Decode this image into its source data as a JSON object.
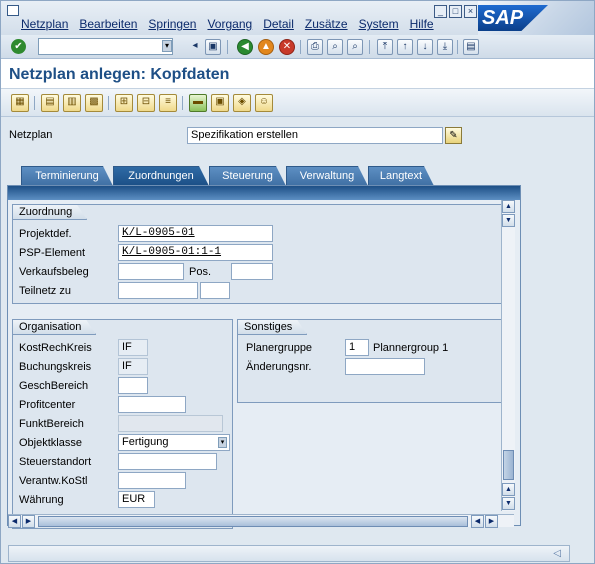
{
  "menubar": {
    "items": [
      "Netzplan",
      "Bearbeiten",
      "Springen",
      "Vorgang",
      "Detail",
      "Zusätze",
      "System",
      "Hilfe"
    ],
    "logo": "SAP"
  },
  "stdbar": {
    "command_value": ""
  },
  "title": "Netzplan anlegen: Kopfdaten",
  "header": {
    "netzplan_label": "Netzplan",
    "netzplan_value": "Spezifikation erstellen"
  },
  "tabs": [
    {
      "label": "Terminierung",
      "active": false
    },
    {
      "label": "Zuordnungen",
      "active": true
    },
    {
      "label": "Steuerung",
      "active": false
    },
    {
      "label": "Verwaltung",
      "active": false
    },
    {
      "label": "Langtext",
      "active": false
    }
  ],
  "zuordnung": {
    "title": "Zuordnung",
    "projektdef_label": "Projektdef.",
    "projektdef_value": "K/L-0905-01",
    "psp_label": "PSP-Element",
    "psp_value": "K/L-0905-01:1-1",
    "verkaufsbeleg_label": "Verkaufsbeleg",
    "verkaufsbeleg_value": "",
    "pos_label": "Pos.",
    "pos_value": "",
    "teilnetz_label": "Teilnetz zu",
    "teilnetz_value": "",
    "teilnetz_value2": ""
  },
  "organisation": {
    "title": "Organisation",
    "kostrechkreis_label": "KostRechKreis",
    "kostrechkreis_value": "IF",
    "buchungskreis_label": "Buchungskreis",
    "buchungskreis_value": "IF",
    "geschbereich_label": "GeschBereich",
    "geschbereich_value": "",
    "profitcenter_label": "Profitcenter",
    "profitcenter_value": "",
    "funktbereich_label": "FunktBereich",
    "funktbereich_value": "",
    "objektklasse_label": "Objektklasse",
    "objektklasse_value": "Fertigung",
    "steuerstandort_label": "Steuerstandort",
    "steuerstandort_value": "",
    "verantw_label": "Verantw.KoStl",
    "verantw_value": "",
    "waehrung_label": "Währung",
    "waehrung_value": "EUR"
  },
  "sonstiges": {
    "title": "Sonstiges",
    "planergruppe_label": "Planergruppe",
    "planergruppe_value": "1",
    "planergruppe_text": "Plannergroup 1",
    "aenderungsnr_label": "Änderungsnr.",
    "aenderungsnr_value": ""
  },
  "status": {
    "text": ""
  }
}
